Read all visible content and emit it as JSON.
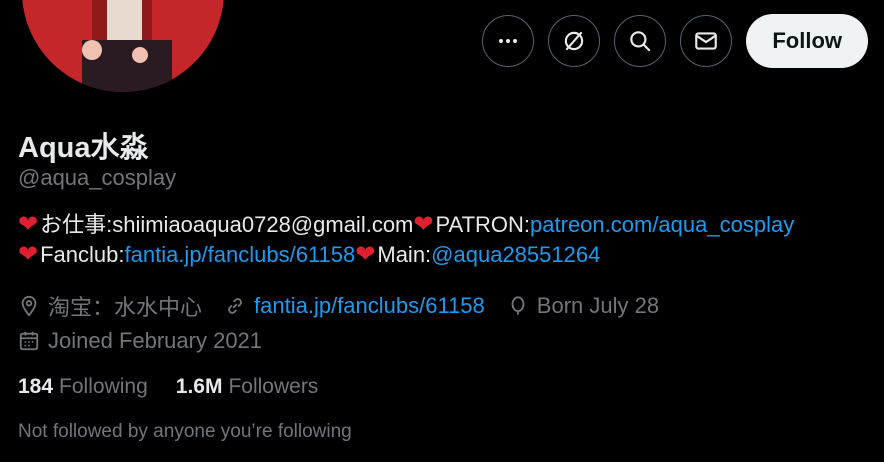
{
  "profile": {
    "display_name": "Aqua水淼",
    "handle": "@aqua_cosplay",
    "bio": {
      "line1": {
        "prefix": "お仕事:shiimiaoaqua0728@gmail.com",
        "label2": "PATRON: ",
        "link": "patreon.com/aqua_cosplay"
      },
      "line2": {
        "label1": "Fanclub: ",
        "link1": "fantia.jp/fanclubs/61158",
        "label2": "Main:",
        "link2": "@aqua28551264"
      }
    },
    "meta": {
      "location": "淘宝：水水中心",
      "website": "fantia.jp/fanclubs/61158",
      "birthday": "Born July 28",
      "joined": "Joined February 2021"
    },
    "stats": {
      "following_count": "184",
      "following_label": "Following",
      "followers_count": "1.6M",
      "followers_label": "Followers"
    },
    "not_followed": "Not followed by anyone you’re following"
  },
  "actions": {
    "follow_label": "Follow",
    "icons": [
      "more-icon",
      "grok-icon",
      "search-icon",
      "message-icon"
    ]
  },
  "colors": {
    "background": "#000000",
    "text": "#e7e9ea",
    "secondary": "#71767b",
    "link": "#1d9bf0",
    "heart": "#e0202e",
    "follow_bg": "#eff3f4"
  }
}
